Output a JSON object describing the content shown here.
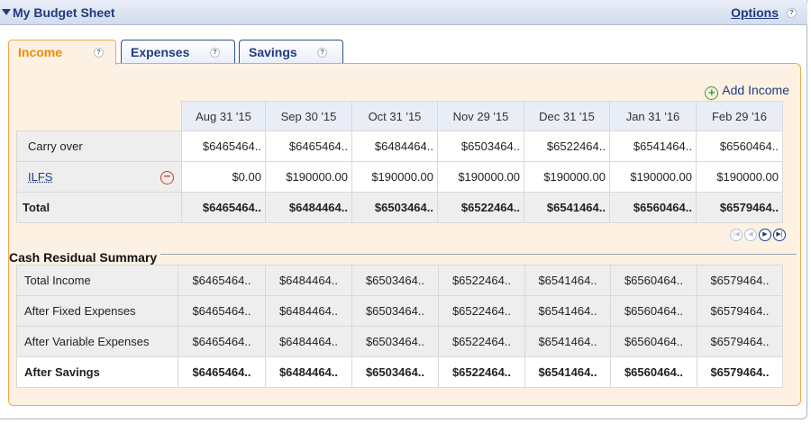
{
  "header": {
    "title": "My Budget Sheet",
    "options_label": "Options",
    "help_glyph": "?"
  },
  "tabs": [
    {
      "label": "Income",
      "active": true
    },
    {
      "label": "Expenses",
      "active": false
    },
    {
      "label": "Savings",
      "active": false
    }
  ],
  "income": {
    "add_label": "Add Income",
    "columns": [
      "Aug 31 '15",
      "Sep 30 '15",
      "Oct 31 '15",
      "Nov 29 '15",
      "Dec 31 '15",
      "Jan 31 '16",
      "Feb 29 '16"
    ],
    "rows": [
      {
        "label": "Carry over",
        "values": [
          "$6465464..",
          "$6465464..",
          "$6484464..",
          "$6503464..",
          "$6522464..",
          "$6541464..",
          "$6560464.."
        ]
      },
      {
        "label": "ILFS",
        "values": [
          "$0.00",
          "$190000.00",
          "$190000.00",
          "$190000.00",
          "$190000.00",
          "$190000.00",
          "$190000.00"
        ]
      },
      {
        "label": "Total",
        "values": [
          "$6465464..",
          "$6484464..",
          "$6503464..",
          "$6522464..",
          "$6541464..",
          "$6560464..",
          "$6579464.."
        ]
      }
    ]
  },
  "pager": {
    "first": "|◀",
    "prev": "◀",
    "next": "▶",
    "last": "▶|"
  },
  "summary": {
    "title": "Cash Residual Summary",
    "rows": [
      {
        "label": "Total Income",
        "values": [
          "$6465464..",
          "$6484464..",
          "$6503464..",
          "$6522464..",
          "$6541464..",
          "$6560464..",
          "$6579464.."
        ]
      },
      {
        "label": "After Fixed Expenses",
        "values": [
          "$6465464..",
          "$6484464..",
          "$6503464..",
          "$6522464..",
          "$6541464..",
          "$6560464..",
          "$6579464.."
        ]
      },
      {
        "label": "After Variable Expenses",
        "values": [
          "$6465464..",
          "$6484464..",
          "$6503464..",
          "$6522464..",
          "$6541464..",
          "$6560464..",
          "$6579464.."
        ]
      },
      {
        "label": "After Savings",
        "values": [
          "$6465464..",
          "$6484464..",
          "$6503464..",
          "$6522464..",
          "$6541464..",
          "$6560464..",
          "$6579464.."
        ]
      }
    ]
  },
  "colors": {
    "accent_orange": "#f28a00",
    "link_blue": "#1f3b80",
    "panel_bg": "#fdf1e3",
    "add_green": "#3aa02d",
    "remove_red": "#d23a2c"
  }
}
